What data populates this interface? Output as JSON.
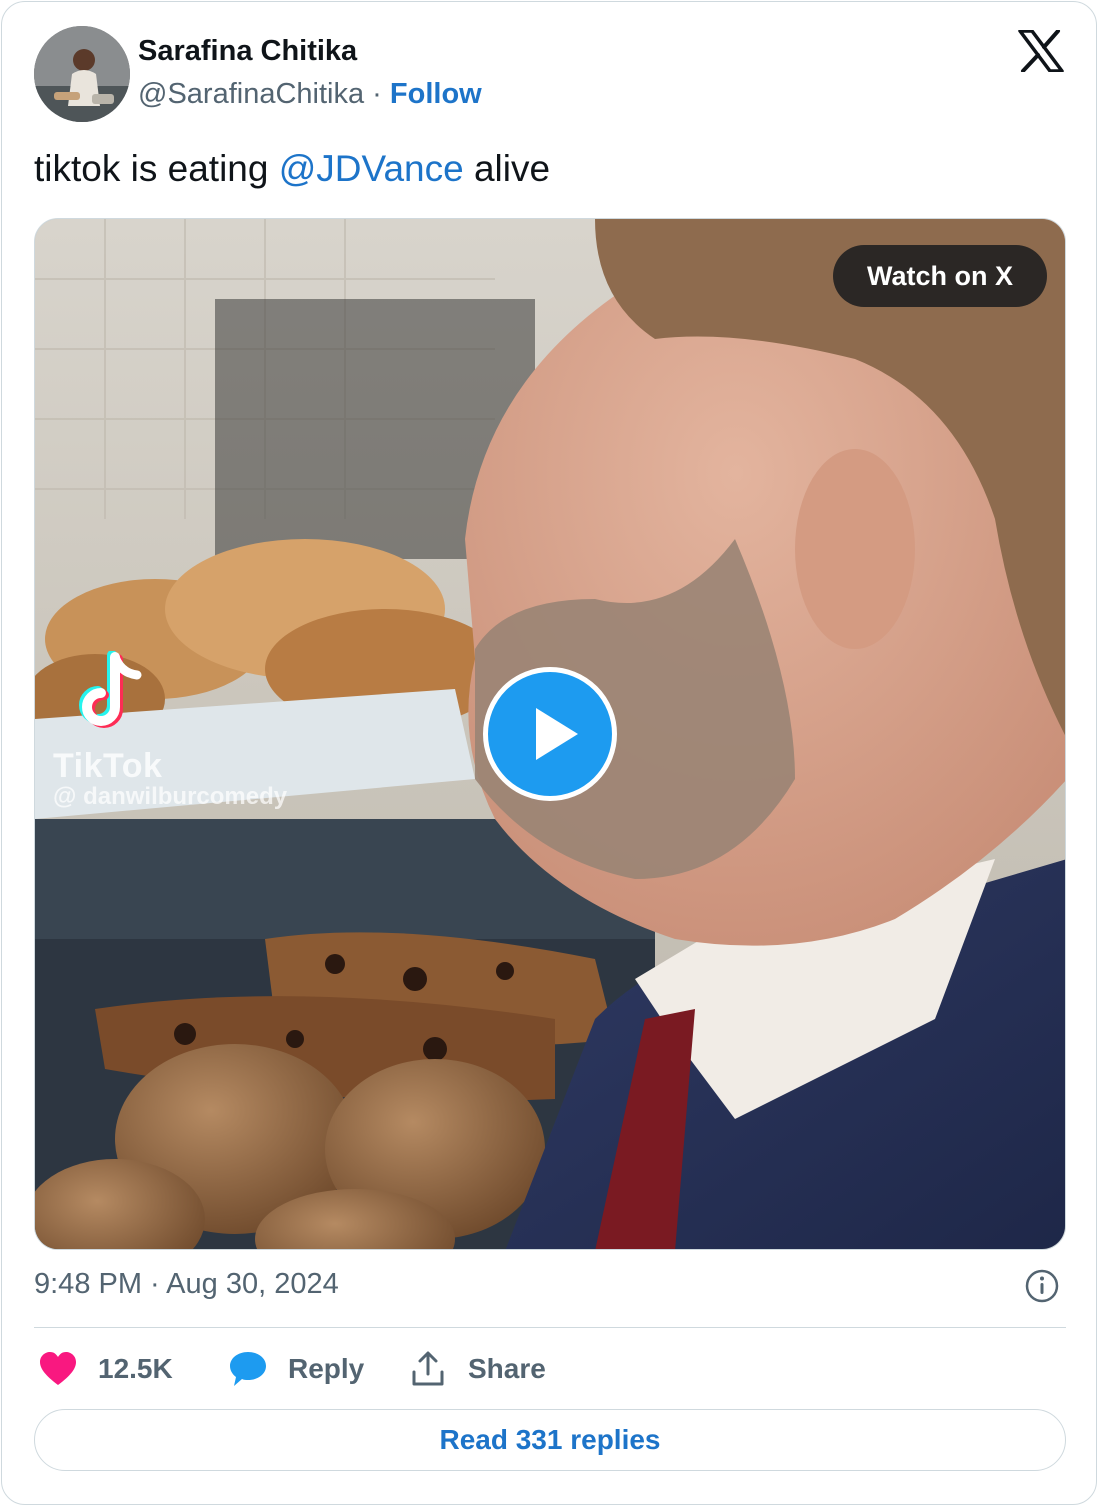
{
  "author": {
    "name": "Sarafina Chitika",
    "handle": "@SarafinaChitika",
    "separator": "·",
    "follow_label": "Follow"
  },
  "tweet": {
    "text_before": "tiktok is eating ",
    "mention": "@JDVance",
    "text_after": " alive"
  },
  "media": {
    "watch_label": "Watch on X",
    "watermark_brand": "TikTok",
    "watermark_user": "@ danwilburcomedy"
  },
  "meta": {
    "timestamp": "9:48 PM · Aug 30, 2024"
  },
  "actions": {
    "likes": "12.5K",
    "reply_label": "Reply",
    "share_label": "Share"
  },
  "read_replies_label": "Read 331 replies",
  "icons": {
    "logo": "x-logo-icon",
    "like": "heart-icon",
    "reply": "reply-bubble-icon",
    "share": "share-upload-icon",
    "info": "info-icon",
    "play": "play-icon"
  },
  "colors": {
    "link": "#1d74c9",
    "like": "#f91880",
    "reply": "#1d9bf0",
    "muted": "#536471"
  }
}
